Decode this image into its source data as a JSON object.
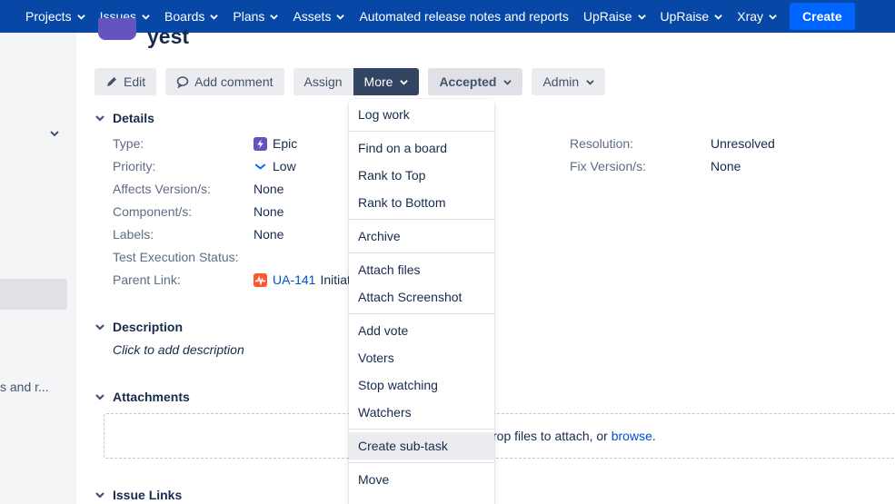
{
  "topnav": {
    "items": [
      {
        "label": "Projects",
        "dropdown": true
      },
      {
        "label": "Issues",
        "dropdown": true
      },
      {
        "label": "Boards",
        "dropdown": true
      },
      {
        "label": "Plans",
        "dropdown": true
      },
      {
        "label": "Assets",
        "dropdown": true
      },
      {
        "label": "Automated release notes and reports",
        "dropdown": false
      },
      {
        "label": "UpRaise",
        "dropdown": true
      },
      {
        "label": "UpRaise",
        "dropdown": true
      },
      {
        "label": "Xray",
        "dropdown": true
      }
    ],
    "create_label": "Create"
  },
  "sidebar": {
    "clipped_text": "s and r..."
  },
  "issue": {
    "title": "yest"
  },
  "toolbar": {
    "edit_label": "Edit",
    "comment_label": "Add comment",
    "assign_label": "Assign",
    "more_label": "More",
    "status_label": "Accepted",
    "admin_label": "Admin"
  },
  "details": {
    "heading": "Details",
    "type_label": "Type:",
    "type_value": "Epic",
    "priority_label": "Priority:",
    "priority_value": "Low",
    "affects_label": "Affects Version/s:",
    "affects_value": "None",
    "component_label": "Component/s:",
    "component_value": "None",
    "labels_label": "Labels:",
    "labels_value": "None",
    "test_exec_label": "Test Execution Status:",
    "parent_label": "Parent Link:",
    "parent_key": "UA-141",
    "parent_summary": "Initiat",
    "resolution_label": "Resolution:",
    "resolution_value": "Unresolved",
    "fixversion_label": "Fix Version/s:",
    "fixversion_value": "None"
  },
  "description": {
    "heading": "Description",
    "hint": "Click to add description"
  },
  "attachments": {
    "heading": "Attachments",
    "drop_text": "rop files to attach, or ",
    "browse_link": "browse",
    "drop_suffix": "."
  },
  "issue_links": {
    "heading": "Issue Links"
  },
  "more_menu": {
    "log_work": "Log work",
    "find_on_board": "Find on a board",
    "rank_top": "Rank to Top",
    "rank_bottom": "Rank to Bottom",
    "archive": "Archive",
    "attach_files": "Attach files",
    "attach_screenshot": "Attach Screenshot",
    "add_vote": "Add vote",
    "voters": "Voters",
    "stop_watching": "Stop watching",
    "watchers": "Watchers",
    "create_subtask": "Create sub-task",
    "move": "Move"
  },
  "colors": {
    "nav_bg": "#0747a6",
    "create_bg": "#0065ff",
    "more_bg": "#344563",
    "epic_purple": "#6554c0",
    "link_blue": "#0052cc"
  },
  "icons": [
    "chevron-down-icon",
    "pencil-icon",
    "comment-icon",
    "epic-icon",
    "low-priority-icon",
    "initiative-icon"
  ]
}
